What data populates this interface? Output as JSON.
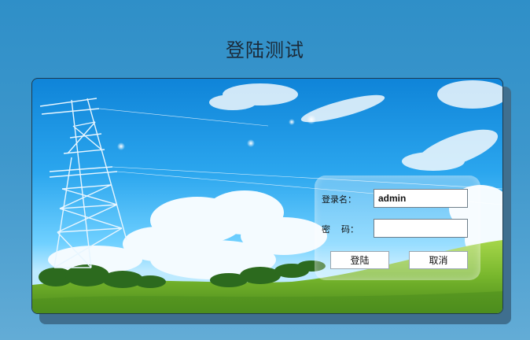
{
  "page": {
    "title": "登陆测试"
  },
  "login": {
    "username_label": "登录名：",
    "username_value": "admin",
    "password_label": "密    码：",
    "password_value": "",
    "login_button": "登陆",
    "cancel_button": "取消"
  },
  "colors": {
    "page_background": "#3d97cc",
    "sky": "#2ba6ee",
    "grass": "#8cc63f",
    "panel_border": "#1e3b4f"
  },
  "icons": [
    "electricity-tower-icon",
    "cloud-icon",
    "tree-icon"
  ]
}
